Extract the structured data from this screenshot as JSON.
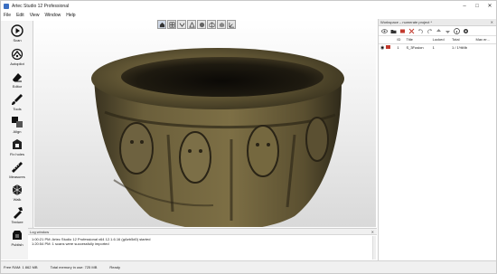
{
  "window": {
    "title": "Artec Studio 12 Professional",
    "controls": [
      "–",
      "□",
      "✕"
    ]
  },
  "menu": [
    "File",
    "Edit",
    "View",
    "Window",
    "Help"
  ],
  "tools": [
    {
      "label": "Scan",
      "icon": "play-icon"
    },
    {
      "label": "Autopilot",
      "icon": "autopilot-icon"
    },
    {
      "label": "Editor",
      "icon": "eraser-icon"
    },
    {
      "label": "Tools",
      "icon": "brush-icon"
    },
    {
      "label": "Align",
      "icon": "align-icon"
    },
    {
      "label": "Fix holes",
      "icon": "fix-holes-icon"
    },
    {
      "label": "Measures",
      "icon": "ruler-icon"
    },
    {
      "label": "Walk",
      "icon": "walk-icon"
    },
    {
      "label": "Texture",
      "icon": "texture-icon"
    },
    {
      "label": "Publish",
      "icon": "publish-icon"
    }
  ],
  "view_toolbar": [
    "home-view-icon",
    "grid-icon",
    "camera-icon",
    "light-icon",
    "shading-icon",
    "wireframe-icon",
    "texture-view-icon",
    "axes-icon"
  ],
  "log": {
    "title": "Log window",
    "lines": [
      "1:00:21 PM: Artec Studio 12 Professional x64 12.1.6.16 (gAeb5d0) started",
      "1:20:54 PM: 1 scans were successfully imported"
    ]
  },
  "status": {
    "free_ram": "Free RAM: 1 862 MB",
    "total_memory": "Total memory in use: 725 MB",
    "state": "Ready"
  },
  "workspace": {
    "title": "Workspace – numerate project *",
    "columns": [
      "",
      "ID",
      "Title",
      "Locked",
      "Total",
      "Max er..."
    ],
    "rows": [
      {
        "id": "1",
        "title": "S_3Fusion",
        "locked": "1",
        "total": "1 / 1%Mb",
        "max_error": ""
      }
    ]
  },
  "colors": {
    "accent": "#3b6fc2",
    "row_swatch": "#c23a2e"
  }
}
